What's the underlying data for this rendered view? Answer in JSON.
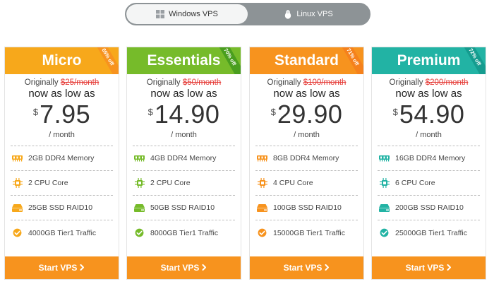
{
  "toggle": {
    "windows_label": "Windows VPS",
    "linux_label": "Linux VPS",
    "active": "windows"
  },
  "colors": {
    "micro": "#f7a81b",
    "essentials": "#76bb2a",
    "standard": "#f7931e",
    "premium": "#22b3a4",
    "button": "#f7931e"
  },
  "plans": [
    {
      "name": "Micro",
      "badge": "65% off",
      "original_prefix": "Originally",
      "original_price": "$25/month",
      "tagline": "now as low as",
      "currency": "$",
      "price": "7.95",
      "period": "/ month",
      "memory": "2GB DDR4 Memory",
      "cpu": "2 CPU Core",
      "storage": "25GB SSD RAID10",
      "traffic": "4000GB Tier1 Traffic",
      "button": "Start VPS"
    },
    {
      "name": "Essentials",
      "badge": "70% off",
      "original_prefix": "Originally",
      "original_price": "$50/month",
      "tagline": "now as low as",
      "currency": "$",
      "price": "14.90",
      "period": "/ month",
      "memory": "4GB DDR4 Memory",
      "cpu": "2 CPU Core",
      "storage": "50GB SSD RAID10",
      "traffic": "8000GB Tier1 Traffic",
      "button": "Start VPS"
    },
    {
      "name": "Standard",
      "badge": "71% off",
      "original_prefix": "Originally",
      "original_price": "$100/month",
      "tagline": "now as low as",
      "currency": "$",
      "price": "29.90",
      "period": "/ month",
      "memory": "8GB DDR4 Memory",
      "cpu": "4 CPU Core",
      "storage": "100GB SSD RAID10",
      "traffic": "15000GB Tier1 Traffic",
      "button": "Start VPS"
    },
    {
      "name": "Premium",
      "badge": "72% off",
      "original_prefix": "Originally",
      "original_price": "$200/month",
      "tagline": "now as low as",
      "currency": "$",
      "price": "54.90",
      "period": "/ month",
      "memory": "16GB DDR4 Memory",
      "cpu": "6 CPU Core",
      "storage": "200GB SSD RAID10",
      "traffic": "25000GB Tier1 Traffic",
      "button": "Start VPS"
    }
  ]
}
